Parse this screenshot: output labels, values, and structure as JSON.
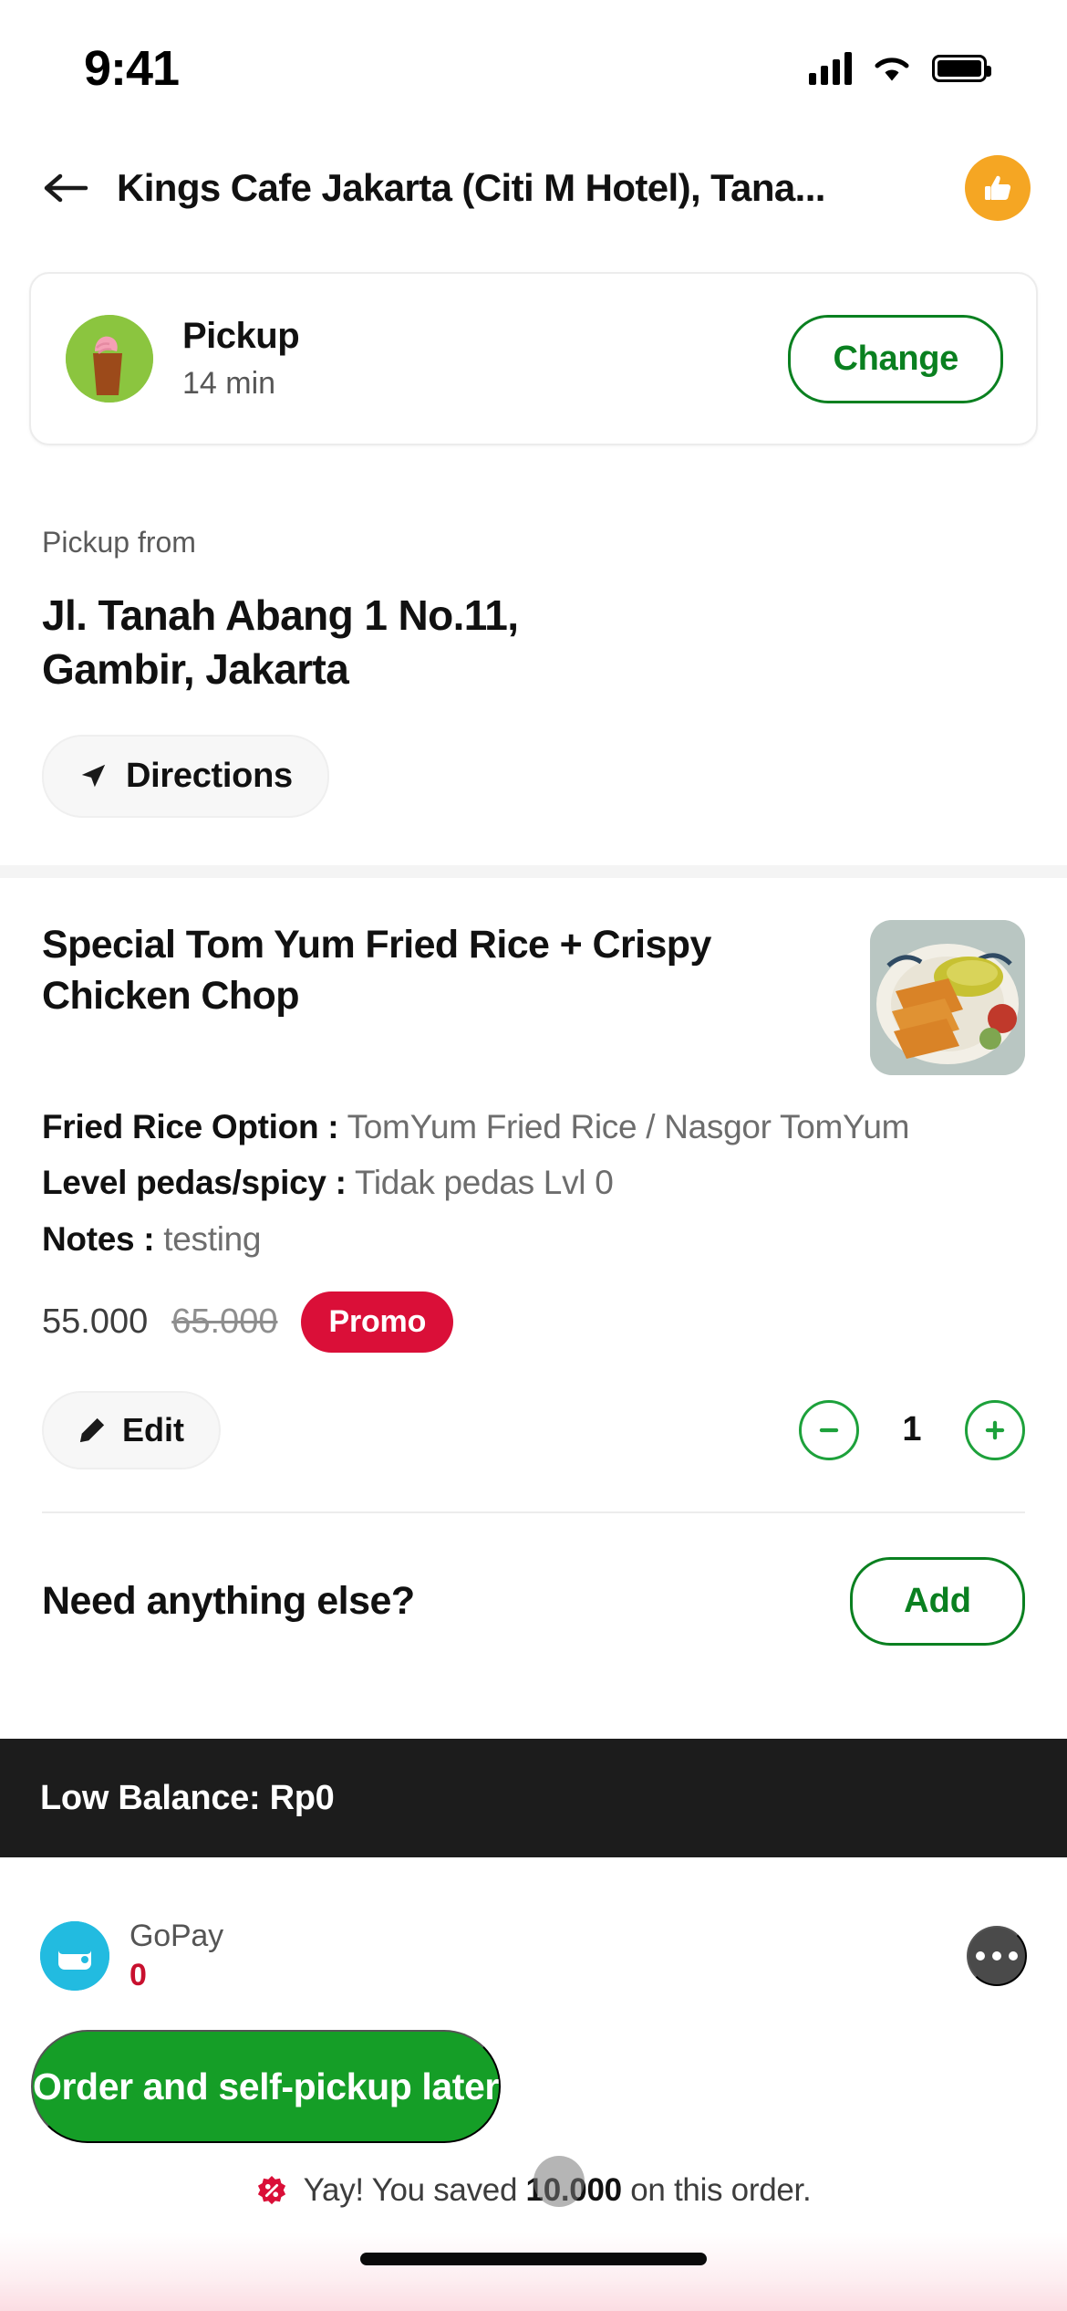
{
  "status_bar": {
    "time": "9:41",
    "icons": [
      "cellular-signal-icon",
      "wifi-icon",
      "battery-icon"
    ]
  },
  "header": {
    "back_icon": "back-arrow-icon",
    "title": "Kings Cafe Jakarta (Citi M Hotel), Tana...",
    "badge_icon": "thumbs-up-icon",
    "badge_color": "#F5A623"
  },
  "pickup_card": {
    "icon": "pickup-bag-icon",
    "title": "Pickup",
    "eta": "14 min",
    "change_label": "Change",
    "accent_color": "#0A8020"
  },
  "address": {
    "label": "Pickup from",
    "value": "Jl. Tanah Abang 1 No.11, Gambir, Jakarta",
    "directions_label": "Directions",
    "directions_icon": "navigation-arrow-icon"
  },
  "item": {
    "name": "Special Tom Yum Fried Rice + Crispy Chicken Chop",
    "thumbnail": "fried-chicken-rice-photo",
    "options": [
      {
        "label": "Fried Rice Option :",
        "value": "TomYum Fried Rice / Nasgor TomYum"
      },
      {
        "label": "Level pedas/spicy :",
        "value": "Tidak pedas Lvl 0"
      },
      {
        "label": "Notes :",
        "value": "testing"
      }
    ],
    "price": "55.000",
    "price_original": "65.000",
    "promo_label": "Promo",
    "promo_color": "#DA0F38",
    "edit_label": "Edit",
    "edit_icon": "pencil-icon",
    "quantity": "1",
    "minus_icon": "minus-icon",
    "plus_icon": "plus-icon"
  },
  "need_more": {
    "title": "Need anything else?",
    "add_label": "Add"
  },
  "toast": {
    "message": "Low Balance: Rp0",
    "background": "#1c1c1c"
  },
  "payment": {
    "icon": "gopay-wallet-icon",
    "name": "GoPay",
    "balance": "0",
    "balance_color": "#C8102E",
    "more_icon": "more-options-icon"
  },
  "cta": {
    "label": "Order and self-pickup later",
    "color": "#159E27"
  },
  "savings": {
    "icon": "discount-percent-icon",
    "prefix": "Yay! You saved ",
    "amount": "10.000",
    "suffix": " on this order."
  }
}
